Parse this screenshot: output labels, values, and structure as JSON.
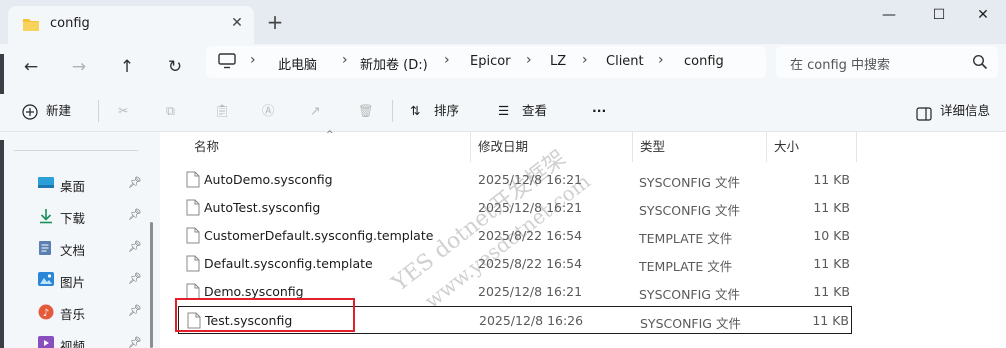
{
  "tab": {
    "title": "config",
    "close": "✕",
    "new": "+"
  },
  "window": {
    "minimize": "—",
    "maximize": "☐",
    "close": "✕"
  },
  "breadcrumb": [
    "此电脑",
    "新加卷 (D:)",
    "Epicor",
    "LZ",
    "Client",
    "config"
  ],
  "search": {
    "placeholder": "在 config 中搜索"
  },
  "toolbar": {
    "new_label": "新建",
    "sort_label": "排序",
    "view_label": "查看",
    "more_label": "···",
    "details_label": "详细信息"
  },
  "columns": {
    "name": "名称",
    "modified": "修改日期",
    "type": "类型",
    "size": "大小"
  },
  "sidebar": {
    "items": [
      {
        "label": "桌面",
        "icon": "desktop-icon"
      },
      {
        "label": "下载",
        "icon": "download-icon"
      },
      {
        "label": "文档",
        "icon": "documents-icon"
      },
      {
        "label": "图片",
        "icon": "pictures-icon"
      },
      {
        "label": "音乐",
        "icon": "music-icon"
      },
      {
        "label": "视频",
        "icon": "videos-icon"
      }
    ]
  },
  "files": [
    {
      "name": "AutoDemo.sysconfig",
      "modified": "2025/12/8 16:21",
      "type": "SYSCONFIG 文件",
      "size": "11 KB"
    },
    {
      "name": "AutoTest.sysconfig",
      "modified": "2025/12/8 16:21",
      "type": "SYSCONFIG 文件",
      "size": "11 KB"
    },
    {
      "name": "CustomerDefault.sysconfig.template",
      "modified": "2025/8/22 16:54",
      "type": "TEMPLATE 文件",
      "size": "10 KB"
    },
    {
      "name": "Default.sysconfig.template",
      "modified": "2025/8/22 16:54",
      "type": "TEMPLATE 文件",
      "size": "11 KB"
    },
    {
      "name": "Demo.sysconfig",
      "modified": "2025/12/8 16:21",
      "type": "SYSCONFIG 文件",
      "size": "11 KB"
    },
    {
      "name": "Test.sysconfig",
      "modified": "2025/12/8 16:26",
      "type": "SYSCONFIG 文件",
      "size": "11 KB"
    }
  ],
  "watermark": {
    "line1": "YES dotnet开发框架",
    "line2": "www.yesdotnet.com"
  },
  "colors": {
    "accent": "#0067c0",
    "highlight": "#e0202a",
    "folder": "#f3c13a"
  }
}
